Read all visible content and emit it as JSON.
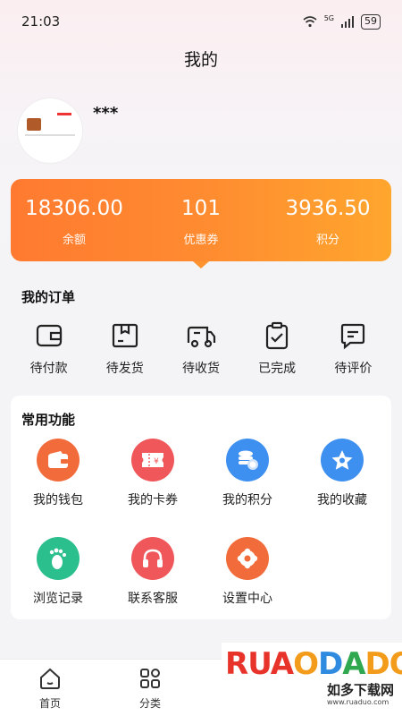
{
  "status_bar": {
    "time": "21:03",
    "network": "5G",
    "battery": "59"
  },
  "header": {
    "title": "我的"
  },
  "profile": {
    "name": "***"
  },
  "stats": [
    {
      "value": "18306.00",
      "label": "余额"
    },
    {
      "value": "101",
      "label": "优惠券"
    },
    {
      "value": "3936.50",
      "label": "积分"
    }
  ],
  "orders": {
    "title": "我的订单",
    "items": [
      {
        "label": "待付款",
        "icon": "wallet-icon"
      },
      {
        "label": "待发货",
        "icon": "box-icon"
      },
      {
        "label": "待收货",
        "icon": "truck-icon"
      },
      {
        "label": "已完成",
        "icon": "clipboard-check-icon"
      },
      {
        "label": "待评价",
        "icon": "comment-icon"
      }
    ]
  },
  "functions": {
    "title": "常用功能",
    "items": [
      {
        "label": "我的钱包",
        "icon": "wallet-icon",
        "color": "#f26b3a"
      },
      {
        "label": "我的卡券",
        "icon": "coupon-icon",
        "color": "#f0575a"
      },
      {
        "label": "我的积分",
        "icon": "coins-icon",
        "color": "#3d8ff0"
      },
      {
        "label": "我的收藏",
        "icon": "star-icon",
        "color": "#3d8ff0"
      },
      {
        "label": "浏览记录",
        "icon": "footprint-icon",
        "color": "#2bbf8e"
      },
      {
        "label": "联系客服",
        "icon": "headphones-icon",
        "color": "#f0575a"
      },
      {
        "label": "设置中心",
        "icon": "settings-icon",
        "color": "#f26b3a"
      }
    ]
  },
  "tabs": [
    {
      "label": "首页",
      "icon": "home-icon"
    },
    {
      "label": "分类",
      "icon": "category-icon"
    }
  ],
  "watermark": {
    "letters": "RUAODADO",
    "text": "如多下载网",
    "url": "www.ruaduo.com"
  }
}
